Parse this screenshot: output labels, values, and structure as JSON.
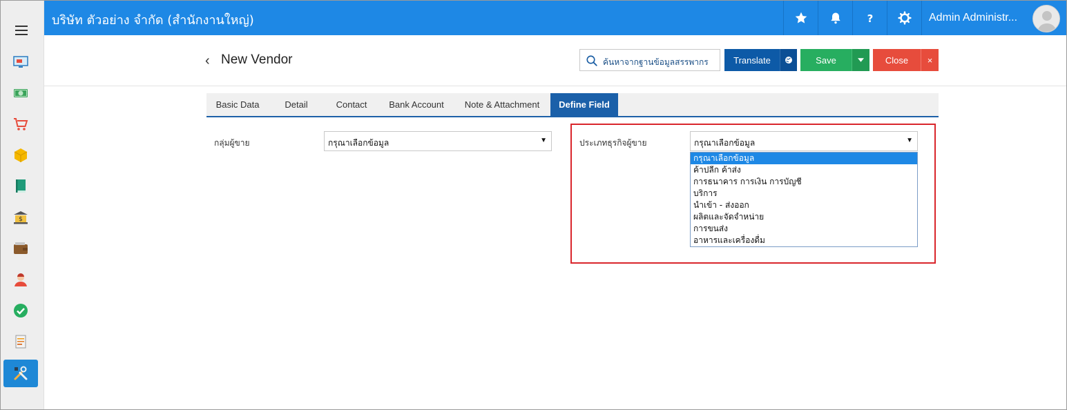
{
  "header": {
    "company": "บริษัท ตัวอย่าง จำกัด (สำนักงานใหญ่)",
    "user_name": "Admin Administr..."
  },
  "sidebar": {
    "items": [
      {
        "icon": "monitor-icon"
      },
      {
        "icon": "money-icon"
      },
      {
        "icon": "cart-icon"
      },
      {
        "icon": "box-icon"
      },
      {
        "icon": "book-icon"
      },
      {
        "icon": "bank-icon"
      },
      {
        "icon": "wallet-icon"
      },
      {
        "icon": "person-icon"
      },
      {
        "icon": "check-icon"
      },
      {
        "icon": "document-icon"
      },
      {
        "icon": "tools-icon"
      }
    ]
  },
  "page": {
    "title": "New Vendor",
    "search_placeholder": "ค้นหาจากฐานข้อมูลสรรพากร",
    "translate_label": "Translate",
    "save_label": "Save",
    "close_label": "Close",
    "close_x": "×"
  },
  "tabs": [
    "Basic Data",
    "Detail",
    "Contact",
    "Bank Account",
    "Note & Attachment",
    "Define Field"
  ],
  "active_tab": "Define Field",
  "form": {
    "vendor_group_label": "กลุ่มผู้ขาย",
    "vendor_group_value": "กรุณาเลือกข้อมูล",
    "business_type_label": "ประเภทธุรกิจผู้ขาย",
    "business_type_value": "กรุณาเลือกข้อมูล",
    "business_type_options": [
      "กรุณาเลือกข้อมูล",
      "ค้าปลีก ค้าส่ง",
      "การธนาคาร การเงิน การบัญชี",
      "บริการ",
      "นำเข้า - ส่งออก",
      "ผลิตและจัดจำหน่าย",
      "การขนส่ง",
      "อาหารและเครื่องดื่ม"
    ]
  },
  "colors": {
    "header_blue": "#1e88e5",
    "tab_active": "#1b60a9",
    "save_green": "#27ae60",
    "close_red": "#e74c3c",
    "highlight_red": "#d9252b"
  }
}
